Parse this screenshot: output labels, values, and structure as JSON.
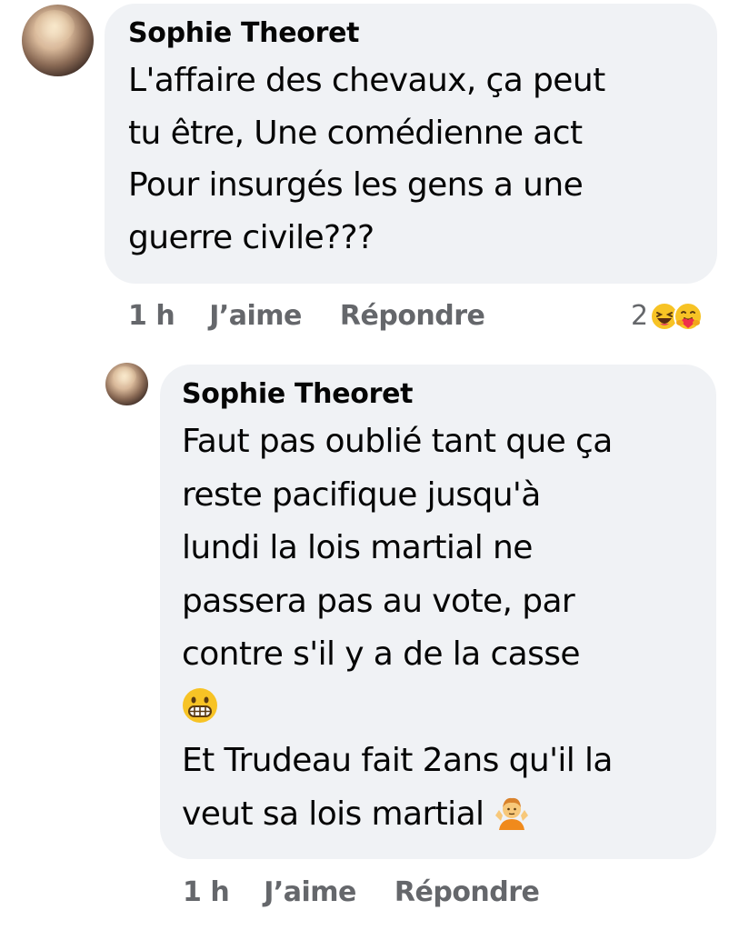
{
  "comments": [
    {
      "author": "Sophie Theoret",
      "text": "L'affaire des chevaux, ça peut\ntu être, Une comédienne act\nPour insurgés les gens a une\nguerre civile???",
      "time": "1 h",
      "like_label": "J’aime",
      "reply_label": "Répondre",
      "reaction_count": "2",
      "reactions": [
        "laughing-face-icon",
        "hugging-face-icon"
      ]
    },
    {
      "author": "Sophie Theoret",
      "text_before_emoji": "Faut pas oublié tant que ça\nreste pacifique jusqu'à\nlundi la lois martial ne\npassera pas au vote, par\ncontre s'il y a de la casse\n",
      "emoji_1": "grimacing-face-icon",
      "text_after_emoji": "\nEt Trudeau fait 2ans qu'il la\nveut sa lois martial ",
      "emoji_2": "person-shrugging-icon",
      "time": "1 h",
      "like_label": "J’aime",
      "reply_label": "Répondre"
    }
  ]
}
